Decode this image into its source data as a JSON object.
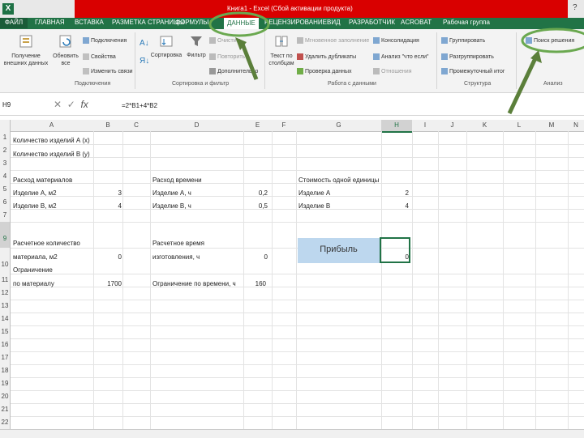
{
  "window": {
    "title": "Книга1 - Excel (Сбой активации продукта)",
    "help": "?"
  },
  "tabs": [
    {
      "label": "ФАЙЛ"
    },
    {
      "label": "ГЛАВНАЯ"
    },
    {
      "label": "ВСТАВКА"
    },
    {
      "label": "РАЗМЕТКА СТРАНИЦЫ"
    },
    {
      "label": "ФОРМУЛЫ"
    },
    {
      "label": "ДАННЫЕ"
    },
    {
      "label": "РЕЦЕНЗИРОВАНИЕ"
    },
    {
      "label": "ВИД"
    },
    {
      "label": "РАЗРАБОТЧИК"
    },
    {
      "label": "ACROBAT"
    },
    {
      "label": "Рабочая группа"
    }
  ],
  "ribbon": {
    "get_external": "Получение внешних данных",
    "refresh_all": "Обновить все",
    "connections": "Подключения",
    "properties": "Свойства",
    "edit_links": "Изменить связи",
    "sort": "Сортировка",
    "filter": "Фильтр",
    "clear": "Очистить",
    "reapply": "Повторить",
    "advanced": "Дополнительно",
    "text_to_columns": "Текст по столбцам",
    "flash_fill": "Мгновенное заполнение",
    "remove_duplicates": "Удалить дубликаты",
    "data_validation": "Проверка данных",
    "consolidate": "Консолидация",
    "what_if": "Анализ \"что если\"",
    "relationships": "Отношения",
    "group": "Группировать",
    "ungroup": "Разгруппировать",
    "subtotal": "Промежуточный итог",
    "solver": "Поиск решения",
    "groups": {
      "connections": "Подключения",
      "sort_filter": "Сортировка и фильтр",
      "data_tools": "Работа с данными",
      "outline": "Структура",
      "analysis": "Анализ"
    }
  },
  "formula_bar": {
    "name_box": "H9",
    "formula": "=2*B1+4*B2"
  },
  "columns": [
    "A",
    "B",
    "C",
    "D",
    "E",
    "F",
    "G",
    "H",
    "I",
    "J",
    "K",
    "L",
    "M",
    "N"
  ],
  "rows": [
    "1",
    "2",
    "3",
    "4",
    "5",
    "6",
    "7",
    "8",
    "9",
    "10",
    "11",
    "12",
    "13",
    "14",
    "15",
    "16",
    "17",
    "18",
    "19",
    "20",
    "21",
    "22"
  ],
  "cells": {
    "A1": "Количество изделий А (x)",
    "A2": "Количество изделий В (y)",
    "A4": "Расход материалов",
    "A5": "Изделие А, м2",
    "B5": "3",
    "A6": "Изделие В, м2",
    "B6": "4",
    "A8": "Расчетное количество",
    "A9": "материала, м2",
    "B9": "0",
    "A10a": "Ограничение",
    "A10b": "по материалу",
    "B10": "1700",
    "D4": "Расход времени",
    "D5": "Изделие А, ч",
    "F5": "0,2",
    "D6": "Изделие В, ч",
    "F6": "0,5",
    "D8": "Расчетное время",
    "D9": "изготовления, ч",
    "F9": "0",
    "D10": "Ограничение по времени, ч",
    "F10": "160",
    "G4": "Стоимость одной единицы",
    "G5": "Изделие А",
    "H5": "2",
    "G6": "Изделие В",
    "H6": "4",
    "G9": "Прибыль",
    "H9": "0"
  },
  "colors": {
    "excel_green": "#217346",
    "title_red": "#d90000",
    "highlight_blue": "#bdd7ee",
    "annotation_green": "#6aa84f",
    "arrow": "#5b7f3a"
  }
}
